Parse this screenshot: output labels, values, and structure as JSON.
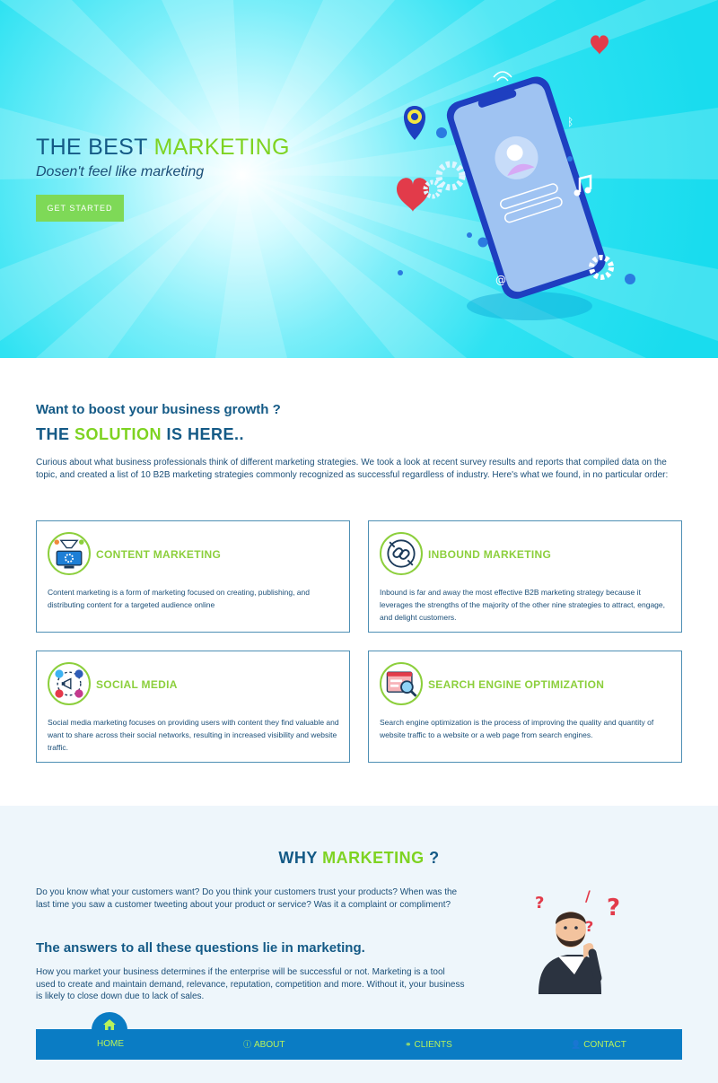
{
  "hero": {
    "title_part1": "THE BEST ",
    "title_accent": "MARKETING",
    "subtitle": "Dosen't feel like marketing",
    "cta_label": "GET STARTED"
  },
  "solution": {
    "question": "Want to boost your business growth ?",
    "heading_pre": "THE ",
    "heading_accent": "SOLUTION",
    "heading_post": " IS HERE..",
    "intro": "Curious about what business professionals think of different marketing strategies. We took a look at recent survey results and reports that compiled data on the topic, and created a list of 10 B2B marketing strategies commonly recognized as successful regardless of industry. Here's what we found, in no particular order:",
    "cards": [
      {
        "icon": "content-marketing-icon",
        "title": "CONTENT MARKETING",
        "text": "Content marketing is a form of marketing focused on creating, publishing, and distributing content for a targeted audience online"
      },
      {
        "icon": "inbound-marketing-icon",
        "title": "INBOUND MARKETING",
        "text": "Inbound is far and away the most effective B2B marketing strategy because it leverages the strengths of the majority of the other nine strategies to attract, engage, and delight customers."
      },
      {
        "icon": "social-media-icon",
        "title": "SOCIAL MEDIA",
        "text": "Social media marketing focuses on providing users with content they find valuable and want to share across their social networks, resulting in increased visibility and website traffic."
      },
      {
        "icon": "seo-icon",
        "title": "SEARCH ENGINE OPTIMIZATION",
        "text": "Search engine optimization is the process of improving the quality and quantity of website traffic to a website or a web page from search engines."
      }
    ]
  },
  "why": {
    "heading_pre": "WHY ",
    "heading_accent": "MARKETING",
    "heading_post": " ?",
    "para1": "Do you know what your customers want? Do you think your customers trust your products? When was the last time you saw a customer tweeting about your product or service? Was it a complaint or compliment?",
    "subheading": "The answers to all these questions lie in marketing.",
    "para2": "How you market your business determines if the enterprise will be successful or not. Marketing is a tool used to create and maintain demand, relevance, reputation, competition and more. Without it, your business is likely to close down due to lack of sales."
  },
  "nav": {
    "items": [
      {
        "label": "HOME",
        "icon": "home-icon"
      },
      {
        "label": "ABOUT",
        "icon": "info-icon"
      },
      {
        "label": "CLIENTS",
        "icon": "handshake-icon"
      },
      {
        "label": "CONTACT",
        "icon": "contact-icon"
      }
    ]
  },
  "colors": {
    "primary": "#145a86",
    "accent": "#7ed321",
    "nav_bg": "#0a7cc4",
    "hero_bg": "#19dcee"
  }
}
